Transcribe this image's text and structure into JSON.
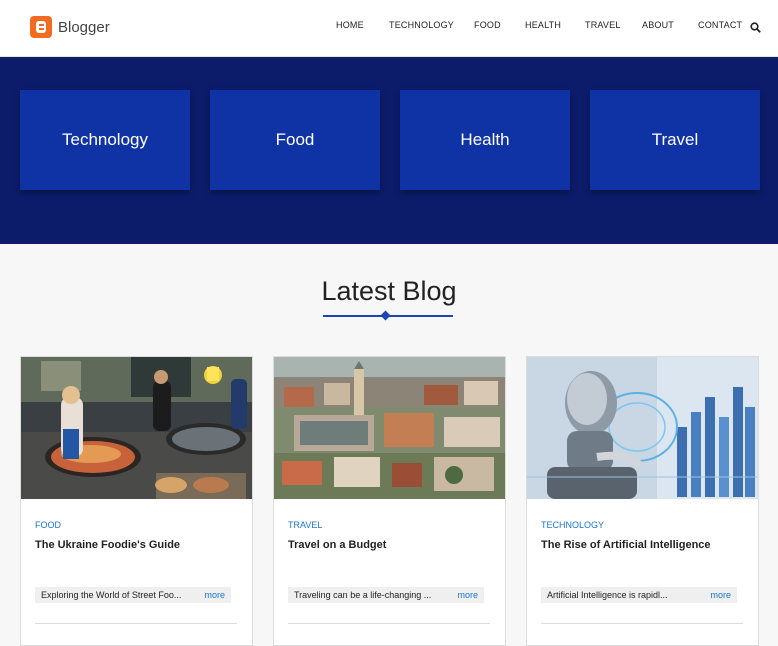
{
  "brand": {
    "name": "Blogger",
    "icon": "blogger-logo-icon",
    "color": "#f26b21"
  },
  "nav": {
    "items": [
      "HOME",
      "TECHNOLOGY",
      "FOOD",
      "HEALTH",
      "TRAVEL",
      "ABOUT",
      "CONTACT"
    ],
    "search_icon": "search-icon"
  },
  "categories": [
    "Technology",
    "Food",
    "Health",
    "Travel"
  ],
  "section": {
    "title": "Latest Blog"
  },
  "posts": [
    {
      "category": "FOOD",
      "title": "The Ukraine Foodie's Guide",
      "excerpt": "Exploring the World of Street Foo...",
      "more": "more",
      "image": "street-food-market-photo"
    },
    {
      "category": "TRAVEL",
      "title": "Travel on a Budget",
      "excerpt": "Traveling can be a life-changing ...",
      "more": "more",
      "image": "city-aerial-photo"
    },
    {
      "category": "TECHNOLOGY",
      "title": "The Rise of Artificial Intelligence",
      "excerpt": "Artificial Intelligence is rapidl...",
      "more": "more",
      "image": "robot-ai-photo"
    }
  ],
  "colors": {
    "hero_bg": "#0c1c6b",
    "card_bg": "#0f33a4",
    "accent": "#1976d2"
  }
}
